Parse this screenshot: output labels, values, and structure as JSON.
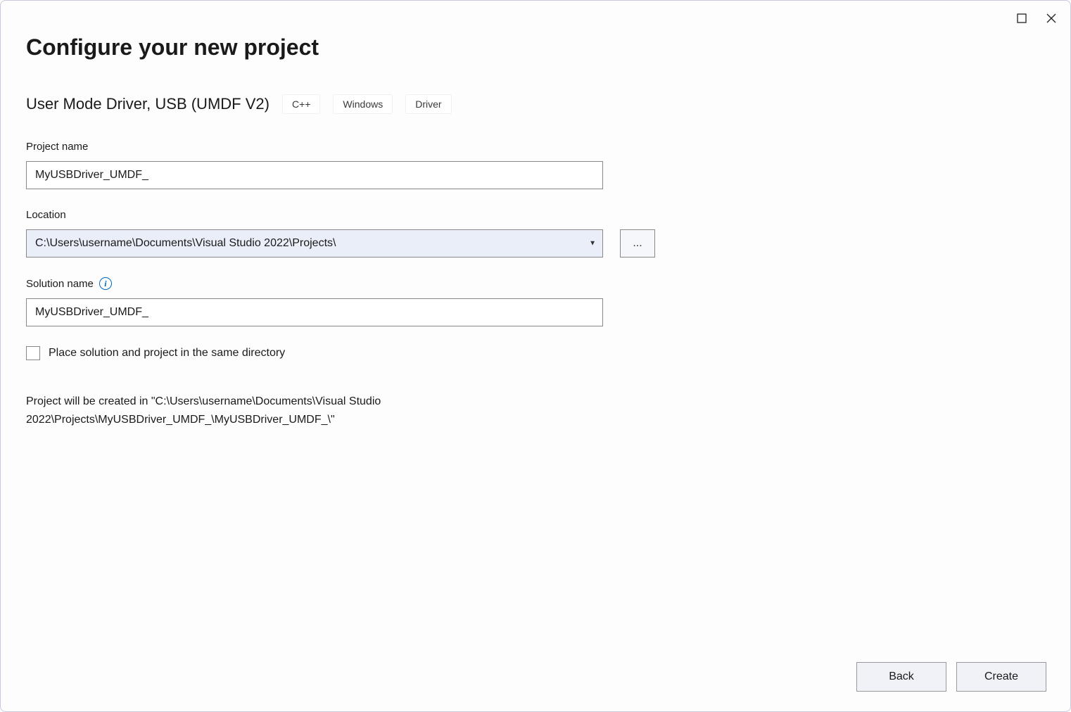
{
  "window": {
    "maximize_icon": "maximize",
    "close_icon": "close"
  },
  "page_title": "Configure your new project",
  "template": {
    "name": "User Mode Driver, USB (UMDF V2)",
    "tags": [
      "C++",
      "Windows",
      "Driver"
    ]
  },
  "fields": {
    "project_name": {
      "label": "Project name",
      "value": "MyUSBDriver_UMDF_"
    },
    "location": {
      "label": "Location",
      "value": "C:\\Users\\username\\Documents\\Visual Studio 2022\\Projects\\",
      "browse_label": "..."
    },
    "solution_name": {
      "label": "Solution name",
      "value": "MyUSBDriver_UMDF_"
    },
    "same_directory": {
      "label": "Place solution and project in the same directory",
      "checked": false
    }
  },
  "summary": "Project will be created in \"C:\\Users\\username\\Documents\\Visual Studio 2022\\Projects\\MyUSBDriver_UMDF_\\MyUSBDriver_UMDF_\\\"",
  "buttons": {
    "back": "Back",
    "create": "Create"
  }
}
